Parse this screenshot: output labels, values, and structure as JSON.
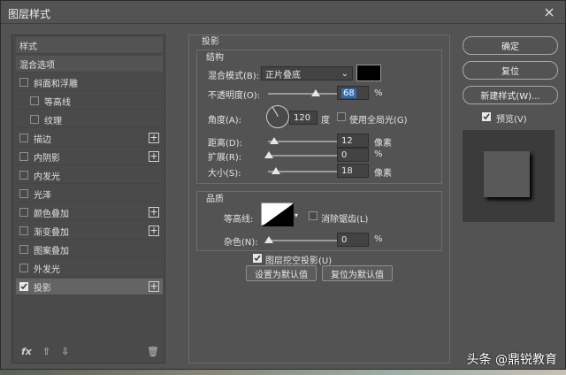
{
  "title": "图层样式",
  "left": {
    "header": "样式",
    "items": [
      {
        "label": "混合选项",
        "checkbox": false,
        "checked": false,
        "indent": 0,
        "plus": false,
        "header": true,
        "selected": false
      },
      {
        "label": "斜面和浮雕",
        "checkbox": true,
        "checked": false,
        "indent": 0,
        "plus": false,
        "selected": false
      },
      {
        "label": "等高线",
        "checkbox": true,
        "checked": false,
        "indent": 1,
        "plus": false,
        "selected": false
      },
      {
        "label": "纹理",
        "checkbox": true,
        "checked": false,
        "indent": 1,
        "plus": false,
        "selected": false
      },
      {
        "label": "描边",
        "checkbox": true,
        "checked": false,
        "indent": 0,
        "plus": true,
        "selected": false
      },
      {
        "label": "内阴影",
        "checkbox": true,
        "checked": false,
        "indent": 0,
        "plus": true,
        "selected": false
      },
      {
        "label": "内发光",
        "checkbox": true,
        "checked": false,
        "indent": 0,
        "plus": false,
        "selected": false
      },
      {
        "label": "光泽",
        "checkbox": true,
        "checked": false,
        "indent": 0,
        "plus": false,
        "selected": false
      },
      {
        "label": "颜色叠加",
        "checkbox": true,
        "checked": false,
        "indent": 0,
        "plus": true,
        "selected": false
      },
      {
        "label": "渐变叠加",
        "checkbox": true,
        "checked": false,
        "indent": 0,
        "plus": true,
        "selected": false
      },
      {
        "label": "图案叠加",
        "checkbox": true,
        "checked": false,
        "indent": 0,
        "plus": false,
        "selected": false
      },
      {
        "label": "外发光",
        "checkbox": true,
        "checked": false,
        "indent": 0,
        "plus": false,
        "selected": false
      },
      {
        "label": "投影",
        "checkbox": true,
        "checked": true,
        "indent": 0,
        "plus": true,
        "selected": true
      }
    ],
    "fx_label": "fx"
  },
  "shadow": {
    "section_title": "投影",
    "structure_title": "结构",
    "blend_mode_label": "混合模式(B):",
    "blend_mode_value": "正片叠底",
    "color": "#000000",
    "opacity_label": "不透明度(O):",
    "opacity_value": "68",
    "opacity_unit": "%",
    "opacity_level": 0.68,
    "angle_label": "角度(A):",
    "angle_value": "120",
    "angle_unit": "度",
    "global_light_label": "使用全局光(G)",
    "distance_label": "距离(D):",
    "distance_value": "12",
    "distance_unit": "像素",
    "spread_label": "扩展(R):",
    "spread_value": "0",
    "spread_unit": "%",
    "size_label": "大小(S):",
    "size_value": "18",
    "size_unit": "像素",
    "quality_title": "品质",
    "contour_label": "等高线:",
    "antialias_label": "消除锯齿(L)",
    "noise_label": "杂色(N):",
    "noise_value": "0",
    "noise_unit": "%",
    "knockout_label": "图层挖空投影(U)",
    "make_default": "设置为默认值",
    "reset_default": "复位为默认值"
  },
  "right": {
    "ok": "确定",
    "reset": "复位",
    "new_style": "新建样式(W)...",
    "preview_label": "预览(V)"
  },
  "watermark": "头条 @鼎锐教育"
}
